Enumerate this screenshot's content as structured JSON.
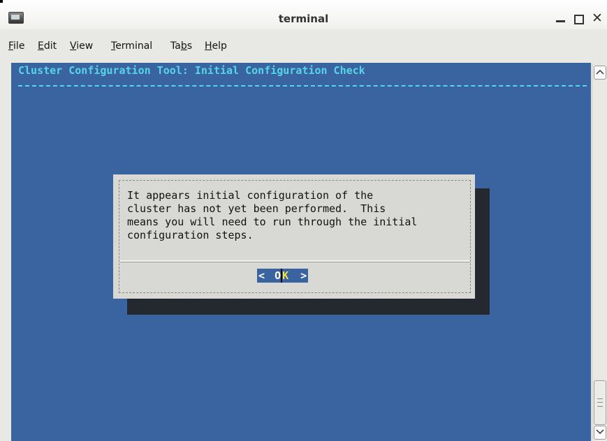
{
  "window": {
    "title": "terminal",
    "minimize_label": "_",
    "close_label": "✕"
  },
  "menu": [
    {
      "label": "File"
    },
    {
      "label": "Edit"
    },
    {
      "label": "View"
    },
    {
      "label": "Terminal"
    },
    {
      "label": "Tabs"
    },
    {
      "label": "Help"
    }
  ],
  "terminal": {
    "header": "Cluster Configuration Tool: Initial Configuration Check",
    "background_color": "#3964a0",
    "header_color": "#57d5e8"
  },
  "dialog": {
    "message": "It appears initial configuration of the\ncluster has not yet been performed.  This\nmeans you will need to run through the initial\nconfiguration steps.",
    "ok_left": "<",
    "ok_o": "O",
    "ok_k": "K",
    "ok_right": ">"
  },
  "scrollbar": {
    "up_icon": "chevron-up-icon",
    "down_icon": "chevron-down-icon"
  }
}
